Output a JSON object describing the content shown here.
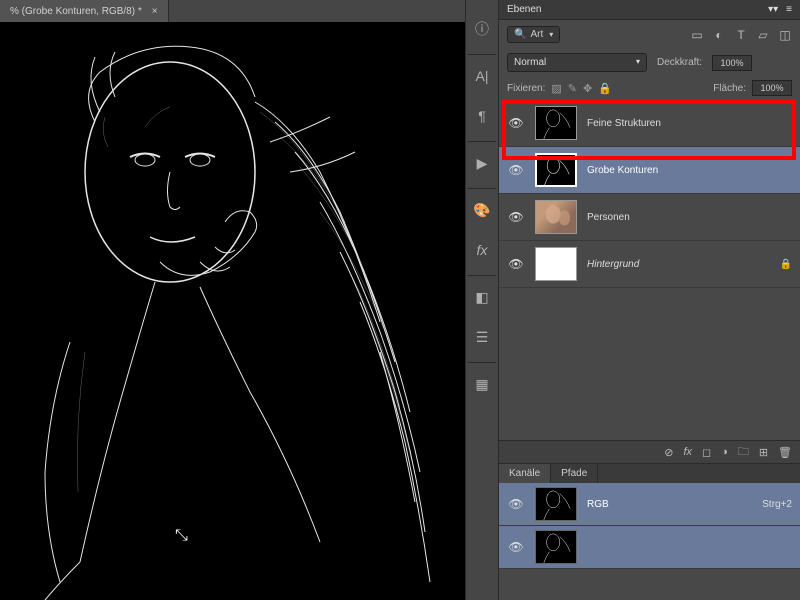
{
  "tab": {
    "title": "% (Grobe Konturen, RGB/8) *",
    "close": "×"
  },
  "panel": {
    "title": "Ebenen",
    "collapse": "▾▾",
    "menu": "≡",
    "filter_label": "Art",
    "blend_mode": "Normal",
    "opacity_label": "Deckkraft:",
    "opacity_value": "100%",
    "lock_label": "Fixieren:",
    "fill_label": "Fläche:",
    "fill_value": "100%"
  },
  "layers": [
    {
      "name": "Feine Strukturen",
      "locked": false
    },
    {
      "name": "Grobe Konturen",
      "locked": false
    },
    {
      "name": "Personen",
      "locked": false
    },
    {
      "name": "Hintergrund",
      "locked": true
    }
  ],
  "channels": {
    "tab1": "Kanäle",
    "tab2": "Pfade",
    "items": [
      {
        "name": "RGB",
        "shortcut": "Strg+2"
      }
    ]
  },
  "lock_symbol": "🔒",
  "eye": "👁"
}
